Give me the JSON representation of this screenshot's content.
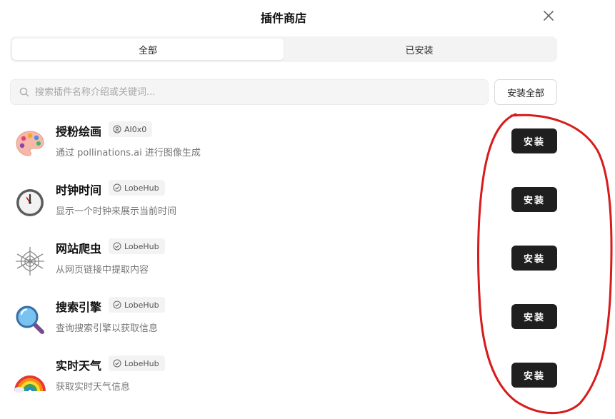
{
  "modal": {
    "title": "插件商店"
  },
  "tabs": [
    {
      "label": "全部",
      "active": true
    },
    {
      "label": "已安装",
      "active": false
    }
  ],
  "search": {
    "placeholder": "搜索插件名称介绍或关键词..."
  },
  "toolbar": {
    "install_all_label": "安装全部"
  },
  "plugins": [
    {
      "name": "授粉绘画",
      "author": "AI0x0",
      "author_icon": "user-circle-icon",
      "desc": "通过 pollinations.ai 进行图像生成",
      "install_label": "安装",
      "icon": "palette-icon"
    },
    {
      "name": "时钟时间",
      "author": "LobeHub",
      "author_icon": "verified-check-icon",
      "desc": "显示一个时钟来展示当前时间",
      "install_label": "安装",
      "icon": "clock-icon"
    },
    {
      "name": "网站爬虫",
      "author": "LobeHub",
      "author_icon": "verified-check-icon",
      "desc": "从网页链接中提取内容",
      "install_label": "安装",
      "icon": "spider-web-icon"
    },
    {
      "name": "搜索引擎",
      "author": "LobeHub",
      "author_icon": "verified-check-icon",
      "desc": "查询搜索引擎以获取信息",
      "install_label": "安装",
      "icon": "magnifier-icon"
    },
    {
      "name": "实时天气",
      "author": "LobeHub",
      "author_icon": "verified-check-icon",
      "desc": "获取实时天气信息",
      "install_label": "安装",
      "icon": "rainbow-icon"
    }
  ],
  "colors": {
    "install_button_bg": "#1f1f1f",
    "annotation_stroke": "#d81b1b"
  }
}
